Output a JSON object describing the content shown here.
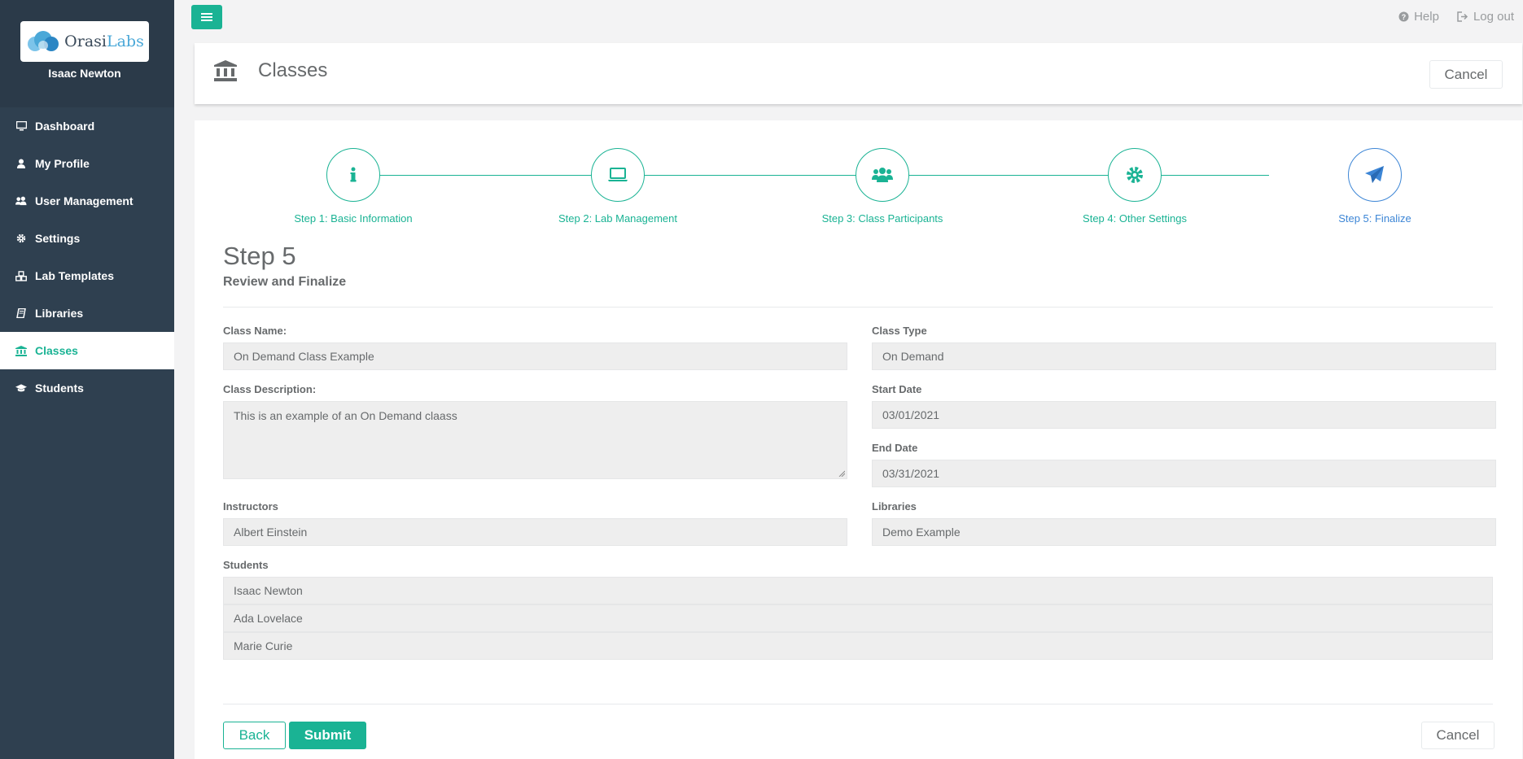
{
  "brand": {
    "logo_text_main": "Orasi",
    "logo_text_accent": "Labs",
    "user_name": "Isaac Newton"
  },
  "nav": {
    "items": [
      {
        "label": "Dashboard",
        "icon": "monitor-icon"
      },
      {
        "label": "My Profile",
        "icon": "user-icon"
      },
      {
        "label": "User Management",
        "icon": "users-icon"
      },
      {
        "label": "Settings",
        "icon": "gear-icon"
      },
      {
        "label": "Lab Templates",
        "icon": "cubes-icon"
      },
      {
        "label": "Libraries",
        "icon": "book-icon"
      },
      {
        "label": "Classes",
        "icon": "institution-icon",
        "active": true
      },
      {
        "label": "Students",
        "icon": "graduation-cap-icon"
      }
    ]
  },
  "topbar": {
    "help_label": "Help",
    "logout_label": "Log out"
  },
  "header": {
    "title": "Classes",
    "cancel_label": "Cancel"
  },
  "wizard": {
    "steps": [
      {
        "label": "Step 1: Basic Information",
        "icon": "info-icon"
      },
      {
        "label": "Step 2: Lab Management",
        "icon": "laptop-icon"
      },
      {
        "label": "Step 3: Class Participants",
        "icon": "users-icon"
      },
      {
        "label": "Step 4: Other Settings",
        "icon": "gear-icon"
      },
      {
        "label": "Step 5: Finalize",
        "icon": "paper-plane-icon",
        "current": true
      }
    ],
    "title": "Step 5",
    "subtitle": "Review and Finalize"
  },
  "form": {
    "class_name_label": "Class Name:",
    "class_name_value": "On Demand Class Example",
    "class_type_label": "Class Type",
    "class_type_value": "On Demand",
    "class_description_label": "Class Description:",
    "class_description_value": "This is an example of an On Demand claass",
    "start_date_label": "Start Date",
    "start_date_value": "03/01/2021",
    "end_date_label": "End Date",
    "end_date_value": "03/31/2021",
    "instructors_label": "Instructors",
    "instructors_value": "Albert  Einstein",
    "libraries_label": "Libraries",
    "libraries_value": "Demo Example",
    "students_label": "Students",
    "students": [
      "Isaac Newton",
      "Ada Lovelace",
      "Marie Curie"
    ]
  },
  "actions": {
    "back_label": "Back",
    "submit_label": "Submit",
    "cancel_label": "Cancel"
  },
  "colors": {
    "accent": "#1ab394",
    "current_step": "#3d86d6",
    "sidebar": "#2f4050"
  }
}
